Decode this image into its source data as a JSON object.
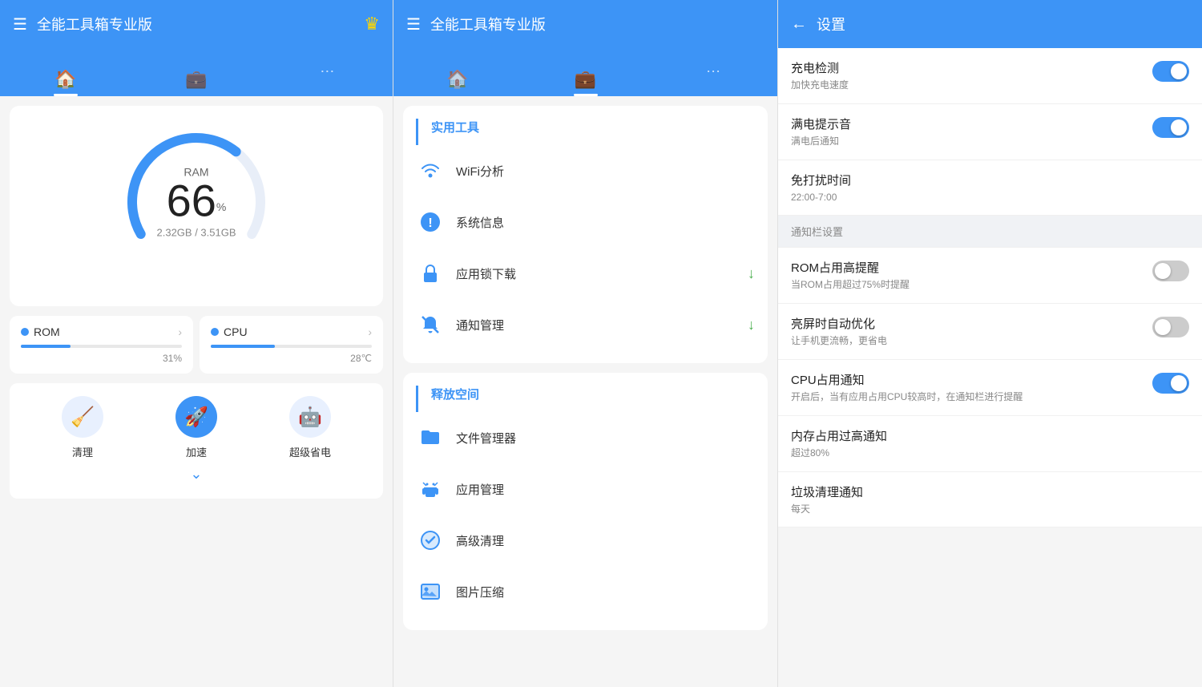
{
  "panel1": {
    "app_title": "全能工具箱专业版",
    "tabs": [
      {
        "label": "home",
        "icon": "🏠",
        "active": true
      },
      {
        "label": "tools",
        "icon": "💼",
        "active": false
      },
      {
        "label": "more",
        "icon": "⋯",
        "active": false
      }
    ],
    "gauge": {
      "label": "RAM",
      "percent": "66",
      "unit": "%",
      "memory": "2.32GB / 3.51GB",
      "value": 66
    },
    "rom": {
      "label": "ROM",
      "percent_text": "31%",
      "percent": 31
    },
    "cpu": {
      "label": "CPU",
      "temp_text": "28℃",
      "percent": 40
    },
    "actions": [
      {
        "label": "清理",
        "icon": "🧹"
      },
      {
        "label": "加速",
        "icon": "🚀"
      },
      {
        "label": "超级省电",
        "icon": "🤖"
      }
    ]
  },
  "panel2": {
    "app_title": "全能工具箱专业版",
    "sections": [
      {
        "title": "实用工具",
        "items": [
          {
            "icon": "📡",
            "label": "WiFi分析",
            "badge": ""
          },
          {
            "icon": "ℹ️",
            "label": "系统信息",
            "badge": ""
          },
          {
            "icon": "🔒",
            "label": "应用锁下载",
            "badge": "↓"
          },
          {
            "icon": "🔕",
            "label": "通知管理",
            "badge": "↓"
          }
        ]
      },
      {
        "title": "释放空间",
        "items": [
          {
            "icon": "📁",
            "label": "文件管理器",
            "badge": ""
          },
          {
            "icon": "🤖",
            "label": "应用管理",
            "badge": ""
          },
          {
            "icon": "⚙️",
            "label": "高级清理",
            "badge": ""
          },
          {
            "icon": "🖼️",
            "label": "图片压缩",
            "badge": ""
          }
        ]
      }
    ]
  },
  "panel3": {
    "title": "设置",
    "back_label": "←",
    "settings": [
      {
        "type": "item",
        "name": "充电检测",
        "desc": "加快充电速度",
        "toggle": true,
        "toggle_on": true
      },
      {
        "type": "item",
        "name": "满电提示音",
        "desc": "满电后通知",
        "toggle": true,
        "toggle_on": true
      },
      {
        "type": "item",
        "name": "免打扰时间",
        "desc": "22:00-7:00",
        "toggle": false,
        "toggle_on": false
      },
      {
        "type": "section",
        "name": "通知栏设置"
      },
      {
        "type": "item",
        "name": "ROM占用高提醒",
        "desc": "当ROM占用超过75%时提醒",
        "toggle": true,
        "toggle_on": false
      },
      {
        "type": "item",
        "name": "亮屏时自动优化",
        "desc": "让手机更流畅，更省电",
        "toggle": true,
        "toggle_on": false
      },
      {
        "type": "item",
        "name": "CPU占用通知",
        "desc": "开启后，当有应用占用CPU较高时，在通知栏进行提醒",
        "toggle": true,
        "toggle_on": true
      },
      {
        "type": "item",
        "name": "内存占用过高通知",
        "desc": "超过80%",
        "toggle": false,
        "toggle_on": false
      },
      {
        "type": "item",
        "name": "垃圾清理通知",
        "desc": "每天",
        "toggle": false,
        "toggle_on": false
      }
    ]
  }
}
